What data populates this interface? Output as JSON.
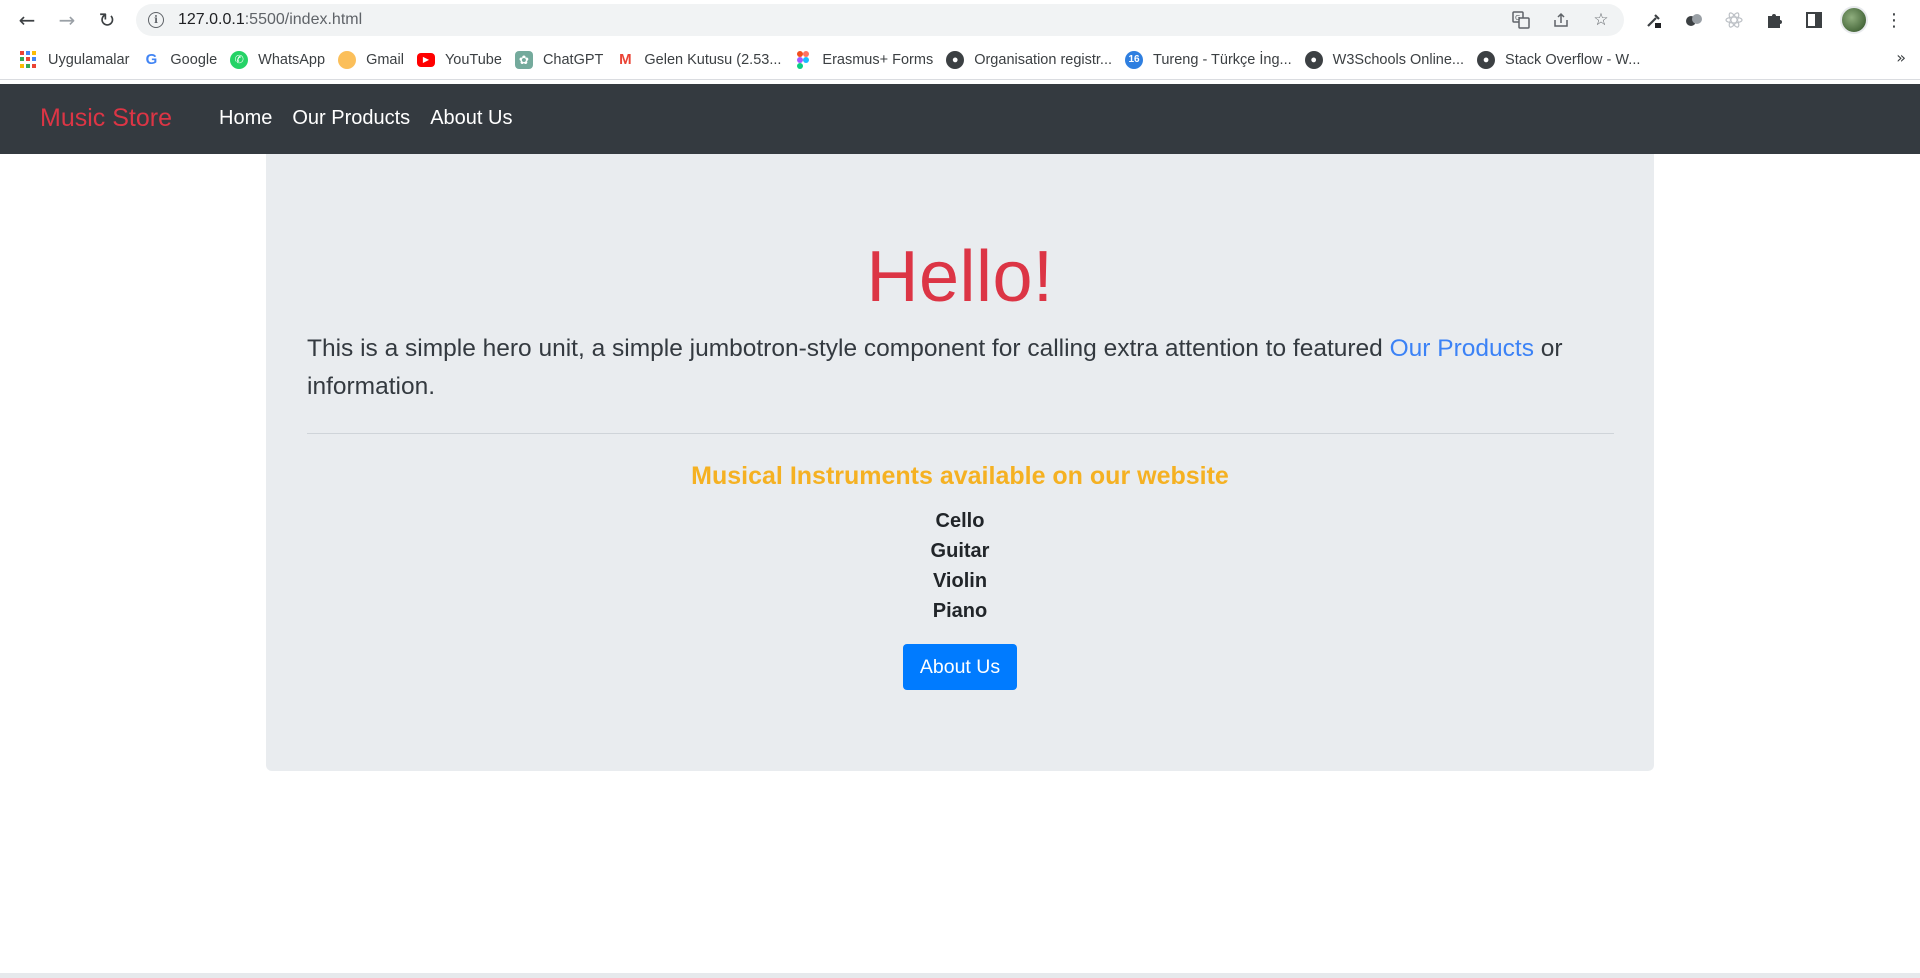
{
  "browser": {
    "url_host": "127.0.0.1",
    "url_path": ":5500/index.html",
    "bookmarks": [
      {
        "label": "Uygulamalar",
        "icon": "apps-grid-icon"
      },
      {
        "label": "Google",
        "icon": "google-icon"
      },
      {
        "label": "WhatsApp",
        "icon": "whatsapp-icon"
      },
      {
        "label": "Gmail",
        "icon": "gmail-icon"
      },
      {
        "label": "YouTube",
        "icon": "youtube-icon"
      },
      {
        "label": "ChatGPT",
        "icon": "chatgpt-icon"
      },
      {
        "label": "Gelen Kutusu (2.53...",
        "icon": "gmail-m-icon"
      },
      {
        "label": "Erasmus+ Forms",
        "icon": "figma-icon"
      },
      {
        "label": "Organisation registr...",
        "icon": "globe-icon"
      },
      {
        "label": "Tureng - Türkçe İng...",
        "icon": "tureng-icon"
      },
      {
        "label": "W3Schools Online...",
        "icon": "globe-icon"
      },
      {
        "label": "Stack Overflow - W...",
        "icon": "globe-icon"
      }
    ],
    "tureng_badge": "16",
    "colors": {
      "chrome_bg": "#ffffff",
      "omnibox_bg": "#f1f3f4"
    }
  },
  "navbar": {
    "brand": "Music Store",
    "links": [
      "Home",
      "Our Products",
      "About Us"
    ],
    "colors": {
      "bg": "#343a40",
      "brand": "#dc3545"
    }
  },
  "hero": {
    "heading": "Hello!",
    "lead_before": "This is a simple hero unit, a simple jumbotron-style component for calling extra attention to featured ",
    "lead_link": "Our Products",
    "lead_after": " or information.",
    "instruments_title": "Musical Instruments available on our website",
    "instruments": [
      "Cello",
      "Guitar",
      "Violin",
      "Piano"
    ],
    "button_label": "About Us",
    "colors": {
      "jumbotron_bg": "#e9ecef",
      "heading": "#dc3545",
      "title": "#f5b122",
      "button": "#007bff",
      "link": "#3b82f6"
    }
  }
}
